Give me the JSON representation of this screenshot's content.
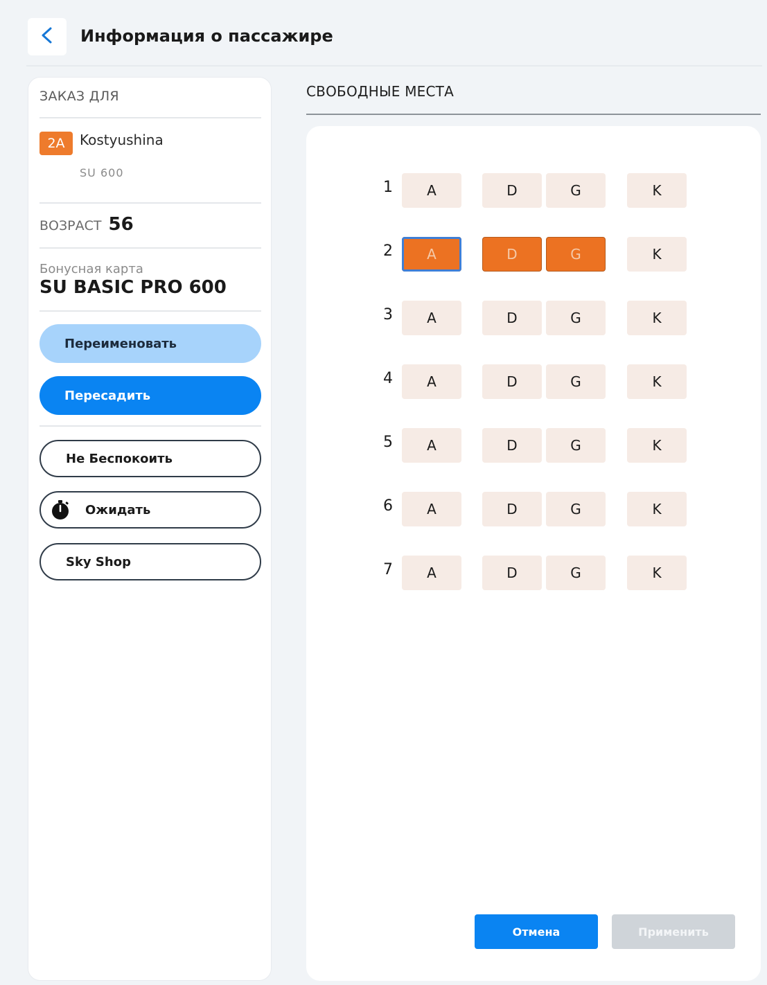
{
  "header": {
    "back_icon": "chevron-left-icon",
    "title": "Информация о пассажире"
  },
  "order": {
    "section_label": "ЗАКАЗ ДЛЯ",
    "seat": "2A",
    "passenger_name": "Kostyushina",
    "flight": "SU  600",
    "age_label": "ВОЗРАСТ",
    "age_value": "56",
    "bonus_label": "Бонусная карта",
    "bonus_value": "SU BASIC PRO 600"
  },
  "actions": {
    "rename": "Переименовать",
    "reseat": "Пересадить",
    "do_not_disturb": "Не Беспокоить",
    "wait": "Ожидать",
    "wait_icon": "timer-icon",
    "sky_shop": "Sky Shop"
  },
  "seat_map": {
    "title": "СВОБОДНЫЕ МЕСТА",
    "columns": [
      "A",
      "D",
      "G",
      "K"
    ],
    "rows": [
      {
        "number": "1",
        "seats": [
          {
            "letter": "A",
            "state": "free"
          },
          {
            "letter": "D",
            "state": "free"
          },
          {
            "letter": "G",
            "state": "free"
          },
          {
            "letter": "K",
            "state": "free"
          }
        ]
      },
      {
        "number": "2",
        "seats": [
          {
            "letter": "A",
            "state": "selected"
          },
          {
            "letter": "D",
            "state": "taken"
          },
          {
            "letter": "G",
            "state": "taken"
          },
          {
            "letter": "K",
            "state": "free"
          }
        ]
      },
      {
        "number": "3",
        "seats": [
          {
            "letter": "A",
            "state": "free"
          },
          {
            "letter": "D",
            "state": "free"
          },
          {
            "letter": "G",
            "state": "free"
          },
          {
            "letter": "K",
            "state": "free"
          }
        ]
      },
      {
        "number": "4",
        "seats": [
          {
            "letter": "A",
            "state": "free"
          },
          {
            "letter": "D",
            "state": "free"
          },
          {
            "letter": "G",
            "state": "free"
          },
          {
            "letter": "K",
            "state": "free"
          }
        ]
      },
      {
        "number": "5",
        "seats": [
          {
            "letter": "A",
            "state": "free"
          },
          {
            "letter": "D",
            "state": "free"
          },
          {
            "letter": "G",
            "state": "free"
          },
          {
            "letter": "K",
            "state": "free"
          }
        ]
      },
      {
        "number": "6",
        "seats": [
          {
            "letter": "A",
            "state": "free"
          },
          {
            "letter": "D",
            "state": "free"
          },
          {
            "letter": "G",
            "state": "free"
          },
          {
            "letter": "K",
            "state": "free"
          }
        ]
      },
      {
        "number": "7",
        "seats": [
          {
            "letter": "A",
            "state": "free"
          },
          {
            "letter": "D",
            "state": "free"
          },
          {
            "letter": "G",
            "state": "free"
          },
          {
            "letter": "K",
            "state": "free"
          }
        ]
      }
    ],
    "cancel_label": "Отмена",
    "apply_label": "Применить"
  },
  "colors": {
    "accent_blue": "#0a84f2",
    "light_blue": "#a7d3fb",
    "seat_free": "#f6ebe5",
    "seat_taken": "#ec7222",
    "badge_orange": "#ee7b2c",
    "disabled_gray": "#cfd4d9"
  }
}
